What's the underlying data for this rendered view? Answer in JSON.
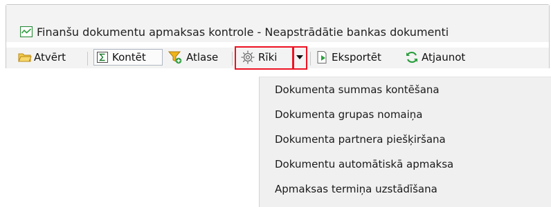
{
  "window": {
    "title": "Finanšu dokumentu apmaksas kontrole - Neapstrādātie bankas dokumenti",
    "title_icon": "chart-window-icon"
  },
  "toolbar": {
    "open_label": "Atvērt",
    "post_label": "Kontēt",
    "filter_label": "Atlase",
    "tools_label": "Rīki",
    "export_label": "Eksportēt",
    "refresh_label": "Atjaunot"
  },
  "tools_menu": {
    "items": [
      "Dokumenta summas kontēšana",
      "Dokumenta grupas nomaiņa",
      "Dokumenta partnera piešķiršana",
      "Dokumentu automātiskā apmaksa",
      "Apmaksas termiņa uzstādīšana"
    ]
  },
  "colors": {
    "highlight": "#ee1122",
    "accent_green": "#2a9d3c",
    "folder_yellow": "#f0c040"
  }
}
